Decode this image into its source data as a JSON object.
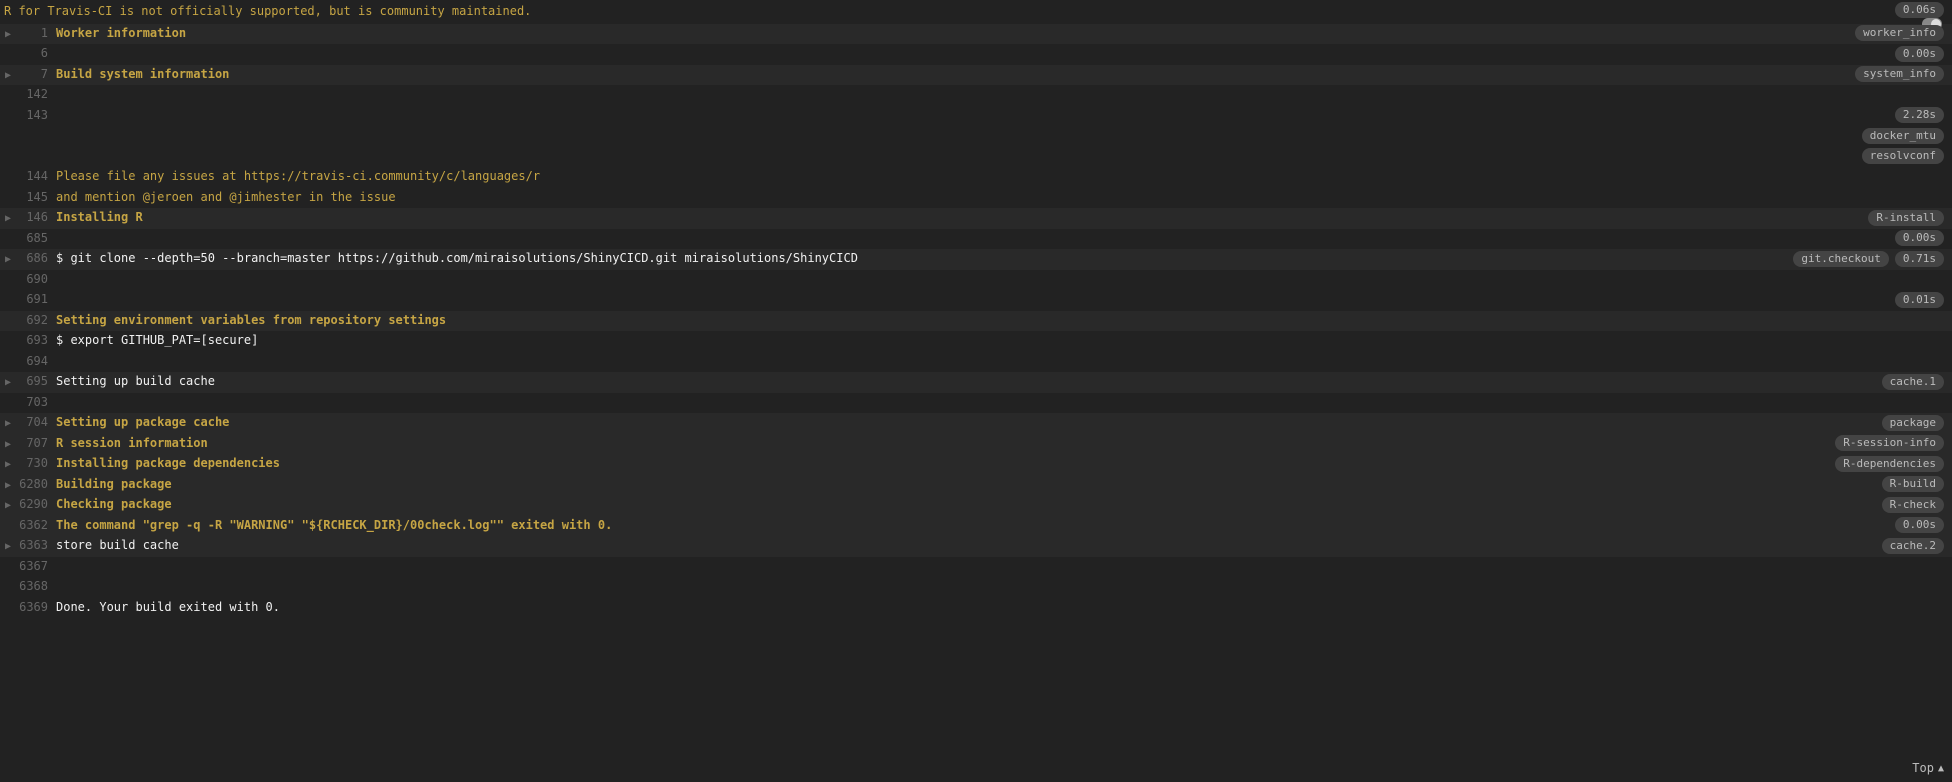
{
  "header": {
    "warning": "R for Travis-CI is not officially supported, but is community maintained.",
    "header_time": "0.06s"
  },
  "lines": [
    {
      "no": "1",
      "arrow": true,
      "text": "Worker information",
      "style": "yellow",
      "shaded": true,
      "badges": [
        "worker_info"
      ]
    },
    {
      "no": "6",
      "arrow": false,
      "text": "",
      "style": "",
      "shaded": false,
      "badges": [
        "0.00s"
      ]
    },
    {
      "no": "7",
      "arrow": true,
      "text": "Build system information",
      "style": "yellow",
      "shaded": true,
      "badges": [
        "system_info"
      ]
    },
    {
      "no": "142",
      "arrow": false,
      "text": "",
      "style": "",
      "shaded": false,
      "badges": []
    },
    {
      "no": "143",
      "arrow": false,
      "text": "",
      "style": "",
      "shaded": false,
      "badges": [
        "2.28s"
      ]
    },
    {
      "no": "",
      "arrow": false,
      "text": "",
      "style": "",
      "shaded": false,
      "badges": [
        "docker_mtu"
      ]
    },
    {
      "no": "",
      "arrow": false,
      "text": "",
      "style": "",
      "shaded": false,
      "badges": [
        "resolvconf"
      ]
    },
    {
      "no": "144",
      "arrow": false,
      "text": "Please file any issues at https://travis-ci.community/c/languages/r",
      "style": "yellow-normal",
      "shaded": false,
      "badges": []
    },
    {
      "no": "145",
      "arrow": false,
      "text": "and mention @jeroen and @jimhester in the issue",
      "style": "yellow-normal",
      "shaded": false,
      "badges": []
    },
    {
      "no": "146",
      "arrow": true,
      "text": "Installing R",
      "style": "yellow",
      "shaded": true,
      "badges": [
        "R-install"
      ]
    },
    {
      "no": "685",
      "arrow": false,
      "text": "",
      "style": "",
      "shaded": false,
      "badges": [
        "0.00s"
      ]
    },
    {
      "no": "686",
      "arrow": true,
      "text": "$ git clone --depth=50 --branch=master https://github.com/miraisolutions/ShinyCICD.git miraisolutions/ShinyCICD",
      "style": "",
      "shaded": true,
      "badges": [
        "git.checkout",
        "0.71s"
      ]
    },
    {
      "no": "690",
      "arrow": false,
      "text": "",
      "style": "",
      "shaded": false,
      "badges": []
    },
    {
      "no": "691",
      "arrow": false,
      "text": "",
      "style": "",
      "shaded": false,
      "badges": [
        "0.01s"
      ]
    },
    {
      "no": "692",
      "arrow": false,
      "text": "Setting environment variables from repository settings",
      "style": "yellow",
      "shaded": true,
      "badges": []
    },
    {
      "no": "693",
      "arrow": false,
      "text": "$ export GITHUB_PAT=[secure]",
      "style": "",
      "shaded": false,
      "badges": []
    },
    {
      "no": "694",
      "arrow": false,
      "text": "",
      "style": "",
      "shaded": false,
      "badges": []
    },
    {
      "no": "695",
      "arrow": true,
      "text": "Setting up build cache",
      "style": "",
      "shaded": true,
      "badges": [
        "cache.1"
      ]
    },
    {
      "no": "703",
      "arrow": false,
      "text": "",
      "style": "",
      "shaded": false,
      "badges": []
    },
    {
      "no": "704",
      "arrow": true,
      "text": "Setting up package cache",
      "style": "yellow",
      "shaded": true,
      "badges": [
        "package"
      ]
    },
    {
      "no": "707",
      "arrow": true,
      "text": "R session information",
      "style": "yellow",
      "shaded": true,
      "badges": [
        "R-session-info"
      ]
    },
    {
      "no": "730",
      "arrow": true,
      "text": "Installing package dependencies",
      "style": "yellow",
      "shaded": true,
      "badges": [
        "R-dependencies"
      ]
    },
    {
      "no": "6280",
      "arrow": true,
      "text": "Building package",
      "style": "yellow",
      "shaded": true,
      "badges": [
        "R-build"
      ]
    },
    {
      "no": "6290",
      "arrow": true,
      "text": "Checking package",
      "style": "yellow",
      "shaded": true,
      "badges": [
        "R-check"
      ]
    },
    {
      "no": "6362",
      "arrow": false,
      "text": "The command \"grep -q -R \"WARNING\" \"${RCHECK_DIR}/00check.log\"\" exited with 0.",
      "style": "yellow",
      "shaded": true,
      "badges": [
        "0.00s"
      ]
    },
    {
      "no": "6363",
      "arrow": true,
      "text": "store build cache",
      "style": "",
      "shaded": true,
      "badges": [
        "cache.2"
      ]
    },
    {
      "no": "6367",
      "arrow": false,
      "text": "",
      "style": "",
      "shaded": false,
      "badges": []
    },
    {
      "no": "6368",
      "arrow": false,
      "text": "",
      "style": "",
      "shaded": false,
      "badges": []
    },
    {
      "no": "6369",
      "arrow": false,
      "text": "Done. Your build exited with 0.",
      "style": "",
      "shaded": false,
      "badges": []
    }
  ],
  "footer": {
    "top_label": "Top"
  }
}
